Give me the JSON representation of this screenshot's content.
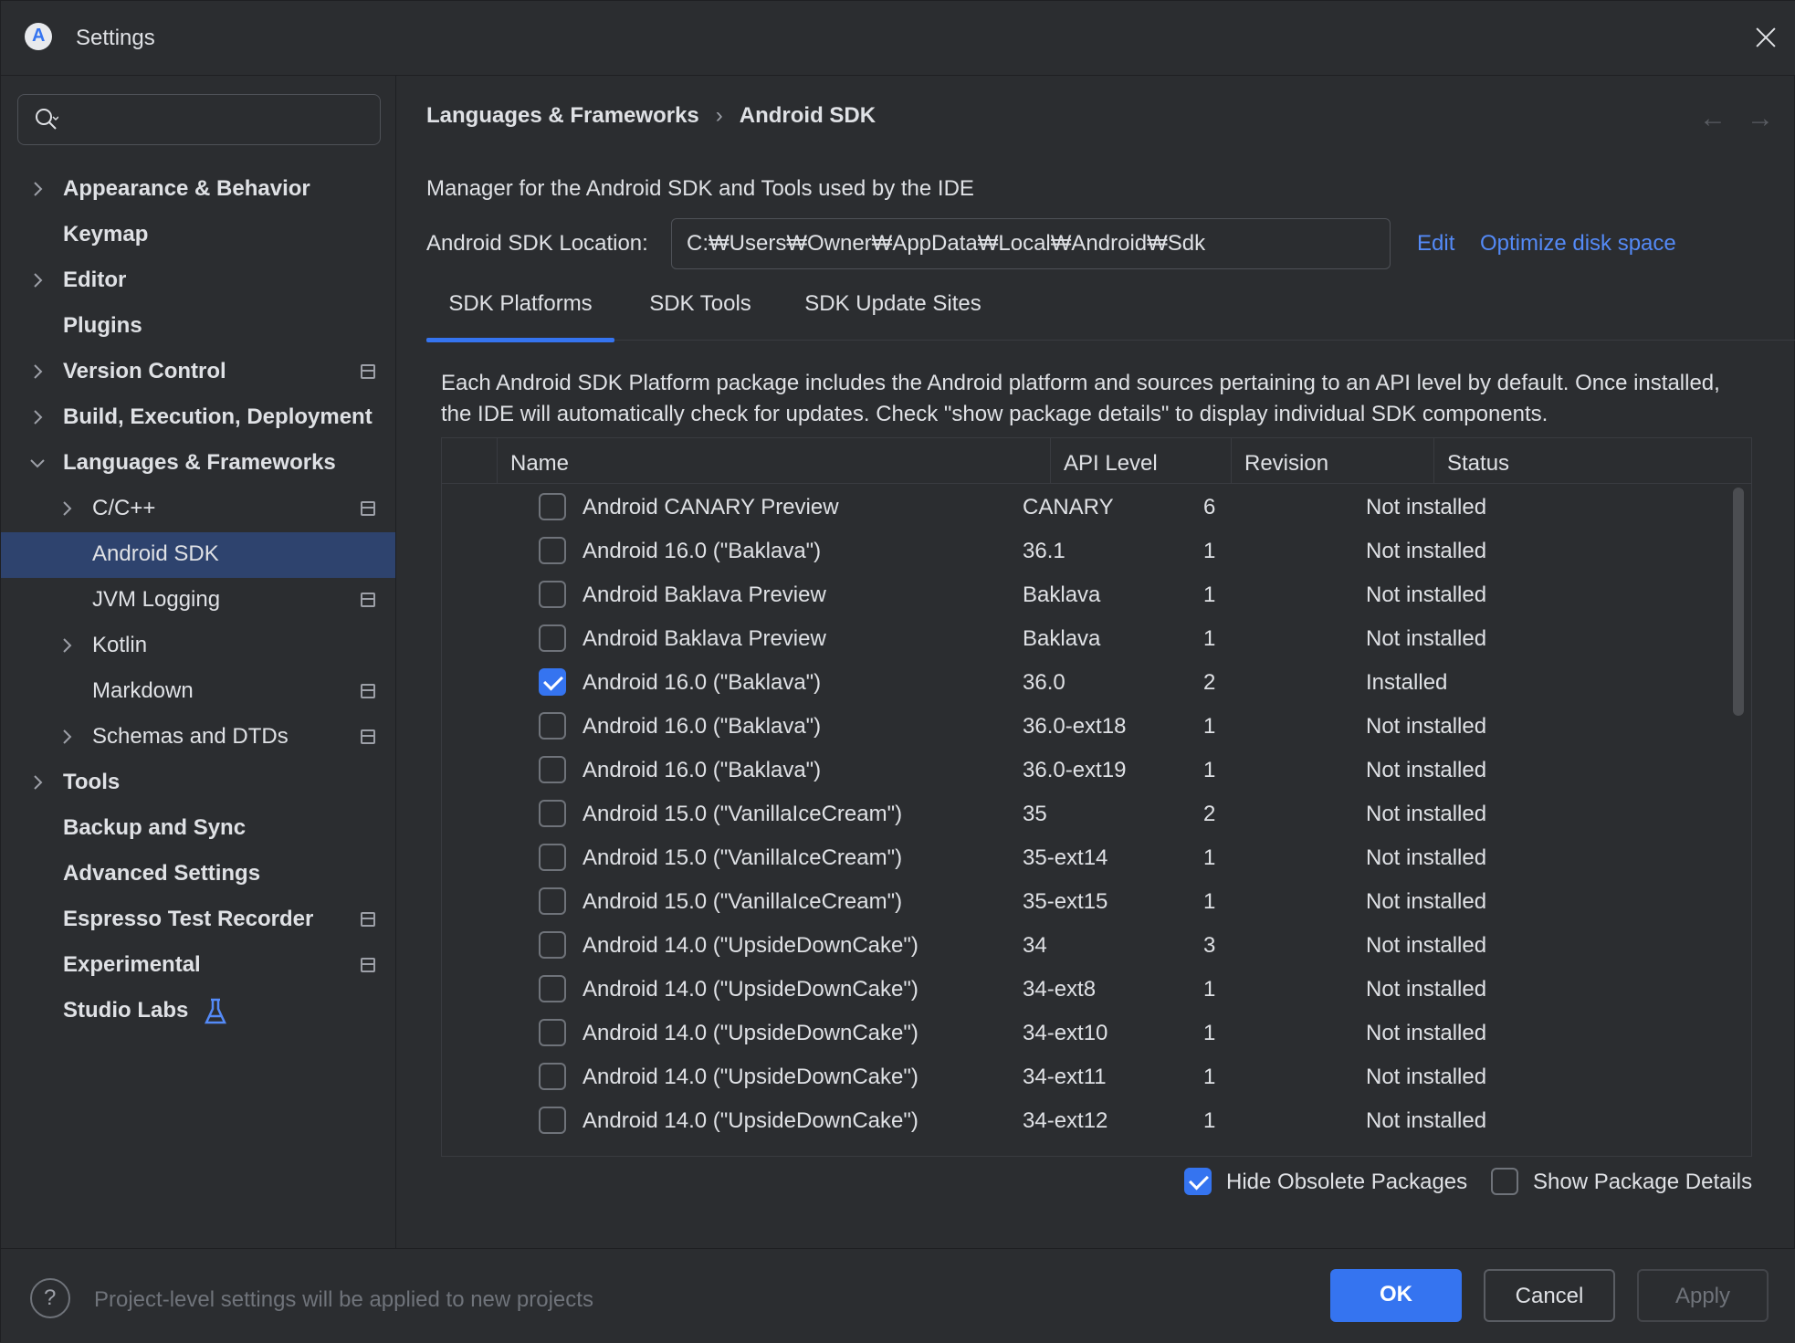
{
  "window": {
    "title": "Settings"
  },
  "sidebar": {
    "search_placeholder": "",
    "items": [
      {
        "label": "Appearance & Behavior",
        "bold": true,
        "indent": 0,
        "chevron": "right",
        "project": false
      },
      {
        "label": "Keymap",
        "bold": true,
        "indent": 0,
        "chevron": "none",
        "project": false
      },
      {
        "label": "Editor",
        "bold": true,
        "indent": 0,
        "chevron": "right",
        "project": false
      },
      {
        "label": "Plugins",
        "bold": true,
        "indent": 0,
        "chevron": "none",
        "project": false
      },
      {
        "label": "Version Control",
        "bold": true,
        "indent": 0,
        "chevron": "right",
        "project": true
      },
      {
        "label": "Build, Execution, Deployment",
        "bold": true,
        "indent": 0,
        "chevron": "right",
        "project": false
      },
      {
        "label": "Languages & Frameworks",
        "bold": true,
        "indent": 0,
        "chevron": "down",
        "project": false
      },
      {
        "label": "C/C++",
        "bold": false,
        "indent": 1,
        "chevron": "right",
        "project": true
      },
      {
        "label": "Android SDK",
        "bold": false,
        "indent": 1,
        "chevron": "none",
        "project": false,
        "selected": true
      },
      {
        "label": "JVM Logging",
        "bold": false,
        "indent": 1,
        "chevron": "none",
        "project": true
      },
      {
        "label": "Kotlin",
        "bold": false,
        "indent": 1,
        "chevron": "right",
        "project": false
      },
      {
        "label": "Markdown",
        "bold": false,
        "indent": 1,
        "chevron": "none",
        "project": true
      },
      {
        "label": "Schemas and DTDs",
        "bold": false,
        "indent": 1,
        "chevron": "right",
        "project": true
      },
      {
        "label": "Tools",
        "bold": true,
        "indent": 0,
        "chevron": "right",
        "project": false
      },
      {
        "label": "Backup and Sync",
        "bold": true,
        "indent": 0,
        "chevron": "none",
        "project": false
      },
      {
        "label": "Advanced Settings",
        "bold": true,
        "indent": 0,
        "chevron": "none",
        "project": false
      },
      {
        "label": "Espresso Test Recorder",
        "bold": true,
        "indent": 0,
        "chevron": "none",
        "project": true
      },
      {
        "label": "Experimental",
        "bold": true,
        "indent": 0,
        "chevron": "none",
        "project": true
      },
      {
        "label": "Studio Labs",
        "bold": true,
        "indent": 0,
        "chevron": "none",
        "project": false,
        "flask": true
      }
    ]
  },
  "main": {
    "breadcrumb": [
      "Languages & Frameworks",
      "Android SDK"
    ],
    "breadcrumb_separator": "›",
    "back_arrow": "←",
    "forward_arrow": "→",
    "description": "Manager for the Android SDK and Tools used by the IDE",
    "location_label": "Android SDK Location:",
    "location_value": "C:₩Users₩Owner₩AppData₩Local₩Android₩Sdk",
    "edit_link": "Edit",
    "optimize_link": "Optimize disk space",
    "tabs": [
      {
        "label": "SDK Platforms",
        "active": true
      },
      {
        "label": "SDK Tools",
        "active": false
      },
      {
        "label": "SDK Update Sites",
        "active": false
      }
    ],
    "info": "Each Android SDK Platform package includes the Android platform and sources pertaining to an API level by default. Once installed, the IDE will automatically check for updates. Check \"show package details\" to display individual SDK components.",
    "table": {
      "columns": [
        "Name",
        "API Level",
        "Revision",
        "Status"
      ],
      "rows": [
        {
          "name": "Android CANARY Preview",
          "api": "CANARY",
          "revision": "6",
          "status": "Not installed",
          "checked": false
        },
        {
          "name": "Android 16.0 (\"Baklava\")",
          "api": "36.1",
          "revision": "1",
          "status": "Not installed",
          "checked": false
        },
        {
          "name": "Android Baklava Preview",
          "api": "Baklava",
          "revision": "1",
          "status": "Not installed",
          "checked": false
        },
        {
          "name": "Android Baklava Preview",
          "api": "Baklava",
          "revision": "1",
          "status": "Not installed",
          "checked": false
        },
        {
          "name": "Android 16.0 (\"Baklava\")",
          "api": "36.0",
          "revision": "2",
          "status": "Installed",
          "checked": true
        },
        {
          "name": "Android 16.0 (\"Baklava\")",
          "api": "36.0-ext18",
          "revision": "1",
          "status": "Not installed",
          "checked": false
        },
        {
          "name": "Android 16.0 (\"Baklava\")",
          "api": "36.0-ext19",
          "revision": "1",
          "status": "Not installed",
          "checked": false
        },
        {
          "name": "Android 15.0 (\"VanillaIceCream\")",
          "api": "35",
          "revision": "2",
          "status": "Not installed",
          "checked": false
        },
        {
          "name": "Android 15.0 (\"VanillaIceCream\")",
          "api": "35-ext14",
          "revision": "1",
          "status": "Not installed",
          "checked": false
        },
        {
          "name": "Android 15.0 (\"VanillaIceCream\")",
          "api": "35-ext15",
          "revision": "1",
          "status": "Not installed",
          "checked": false
        },
        {
          "name": "Android 14.0 (\"UpsideDownCake\")",
          "api": "34",
          "revision": "3",
          "status": "Not installed",
          "checked": false
        },
        {
          "name": "Android 14.0 (\"UpsideDownCake\")",
          "api": "34-ext8",
          "revision": "1",
          "status": "Not installed",
          "checked": false
        },
        {
          "name": "Android 14.0 (\"UpsideDownCake\")",
          "api": "34-ext10",
          "revision": "1",
          "status": "Not installed",
          "checked": false
        },
        {
          "name": "Android 14.0 (\"UpsideDownCake\")",
          "api": "34-ext11",
          "revision": "1",
          "status": "Not installed",
          "checked": false
        },
        {
          "name": "Android 14.0 (\"UpsideDownCake\")",
          "api": "34-ext12",
          "revision": "1",
          "status": "Not installed",
          "checked": false
        }
      ]
    },
    "hide_obsolete": {
      "label": "Hide Obsolete Packages",
      "checked": true
    },
    "show_details": {
      "label": "Show Package Details",
      "checked": false
    }
  },
  "footer": {
    "note": "Project-level settings will be applied to new projects",
    "ok": "OK",
    "cancel": "Cancel",
    "apply": "Apply"
  },
  "colors": {
    "background": "#2b2d30",
    "accent": "#3574f0",
    "selection": "#2e436e",
    "link": "#548af7"
  }
}
